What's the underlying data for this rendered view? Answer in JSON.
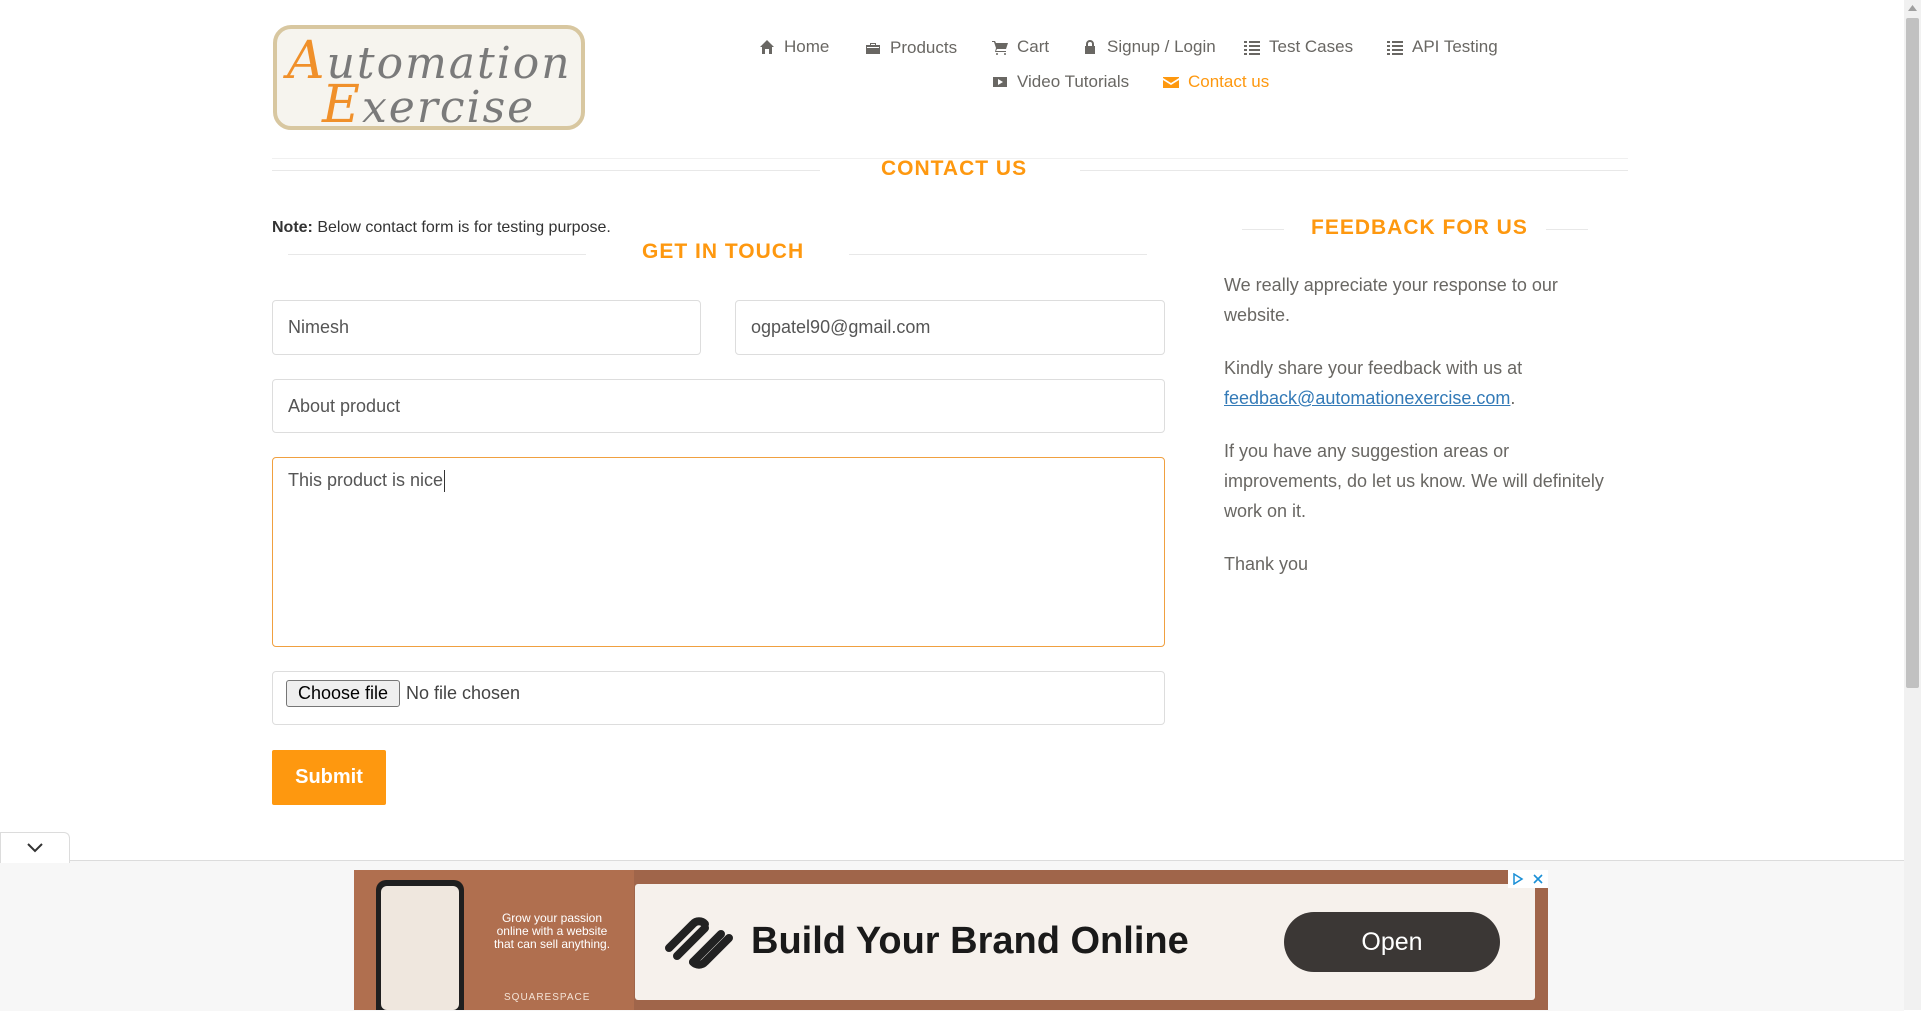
{
  "logo": {
    "line1_first": "A",
    "line1_rest": "utomation",
    "line2_first": "E",
    "line2_rest": "xercise"
  },
  "nav": {
    "home": "Home",
    "products": "Products",
    "cart": "Cart",
    "signup": "Signup / Login",
    "test_cases": "Test Cases",
    "api_testing": "API Testing",
    "video_tutorials": "Video Tutorials",
    "contact_us": "Contact us"
  },
  "page_title": "CONTACT US",
  "note": {
    "label": "Note:",
    "text": " Below contact form is for testing purpose."
  },
  "get_in_touch": "GET IN TOUCH",
  "form": {
    "name_value": "Nimesh",
    "email_value": "ogpatel90@gmail.com",
    "subject_value": "About product",
    "message_value": "This product is nice",
    "file_button": "Choose file",
    "file_status": "No file chosen",
    "submit": "Submit"
  },
  "feedback": {
    "title": "FEEDBACK FOR US",
    "p1": "We really appreciate your response to our website.",
    "p2_text": "Kindly share your feedback with us at ",
    "p2_link": "feedback@automationexercise.com",
    "p2_end": ".",
    "p3": "If you have any suggestion areas or improvements, do let us know. We will definitely work on it.",
    "p4": "Thank you"
  },
  "ad": {
    "left_text": "Grow your passion online with a website that can sell anything.",
    "left_brand": "SQUARESPACE",
    "headline": "Build Your Brand Online",
    "cta": "Open"
  },
  "colors": {
    "accent": "#fe980f",
    "link": "#337ab7",
    "text": "#696763"
  }
}
